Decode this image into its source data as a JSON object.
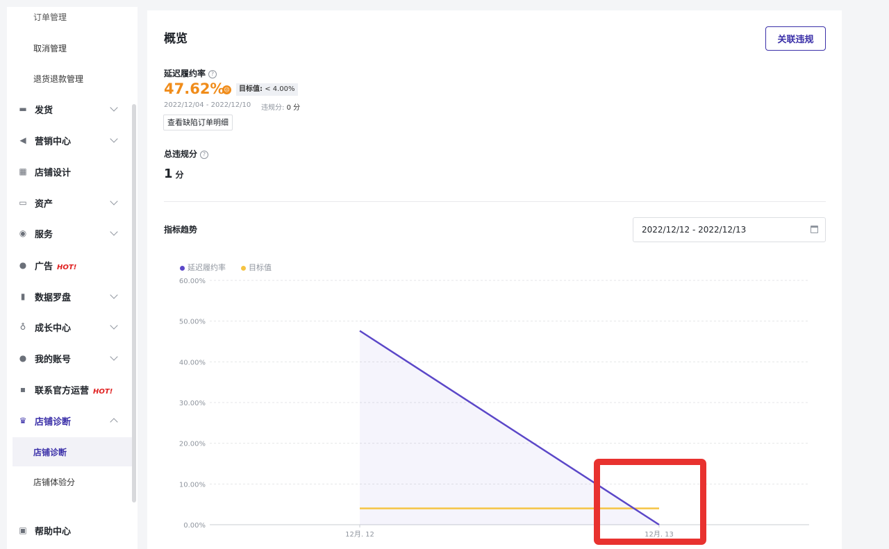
{
  "sidebar": {
    "sub_top_partial": "订单管理",
    "sub_items": [
      "取消管理",
      "退货退款管理"
    ],
    "items": [
      {
        "label": "发货",
        "icon": "truck-icon",
        "chevron": "down"
      },
      {
        "label": "营销中心",
        "icon": "megaphone-icon",
        "chevron": "down"
      },
      {
        "label": "店铺设计",
        "icon": "store-icon",
        "chevron": ""
      },
      {
        "label": "资产",
        "icon": "card-icon",
        "chevron": "down"
      },
      {
        "label": "服务",
        "icon": "globe-icon",
        "chevron": "down"
      },
      {
        "label": "广告",
        "icon": "ad-icon",
        "chevron": "",
        "hot": "HOT!"
      },
      {
        "label": "数据罗盘",
        "icon": "bar-chart-icon",
        "chevron": "down"
      },
      {
        "label": "成长中心",
        "icon": "medal-icon",
        "chevron": "down"
      },
      {
        "label": "我的账号",
        "icon": "user-icon",
        "chevron": "down"
      },
      {
        "label": "联系官方运营",
        "icon": "chat-icon",
        "chevron": "",
        "hot": "HOT!"
      },
      {
        "label": "店铺诊断",
        "icon": "trophy-icon",
        "chevron": "up"
      }
    ],
    "diag_sub": [
      "店铺诊断",
      "店铺体验分"
    ],
    "help": {
      "label": "帮助中心",
      "icon": "help-icon"
    }
  },
  "overview": {
    "title": "概览",
    "violation_button": "关联违规",
    "metric_label": "延迟履约率",
    "metric_value": "47.62%",
    "target_label": "目标值:",
    "target_value": "< 4.00%",
    "date_range": "2022/12/04 - 2022/12/10",
    "score_label": "违规分:",
    "score_value": "0 分",
    "detail_button": "查看缺陷订单明细",
    "total_label": "总违规分",
    "total_value": "1",
    "total_unit": "分"
  },
  "trend": {
    "title": "指标趋势",
    "date_picker": "2022/12/12 - 2022/12/13"
  },
  "chart_data": {
    "type": "line",
    "x": [
      "12月. 12",
      "12月. 13"
    ],
    "series": [
      {
        "name": "延迟履约率",
        "values": [
          47.62,
          0
        ],
        "color": "#5b47c8",
        "area": true
      },
      {
        "name": "目标值",
        "values": [
          4.0,
          4.0
        ],
        "color": "#f5c342"
      }
    ],
    "yticks": [
      "60.00%",
      "50.00%",
      "40.00%",
      "30.00%",
      "20.00%",
      "10.00%",
      "0.00%"
    ],
    "ylim": [
      0,
      60
    ],
    "grid": true,
    "legend": "top-left"
  },
  "colors": {
    "accent": "#3a2fa8",
    "warning": "#f08c1a",
    "highlight": "#e8322f"
  }
}
